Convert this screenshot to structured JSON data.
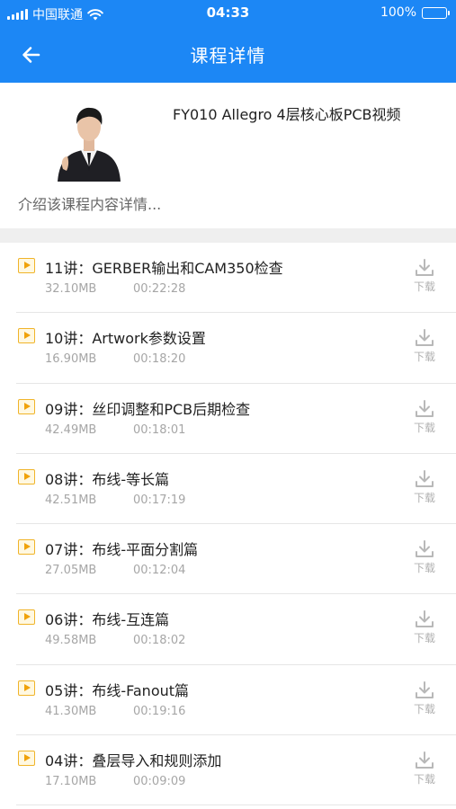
{
  "status_bar": {
    "carrier": "中国联通",
    "time": "04:33",
    "battery": "100%",
    "battery_color": "#4cd964"
  },
  "nav": {
    "title": "课程详情",
    "back_icon": "arrow-left-icon",
    "background": "#1c87f5"
  },
  "course": {
    "title": "FY010 Allegro 4层核心板PCB视频",
    "description": "介绍该课程内容详情..."
  },
  "lessons": [
    {
      "title": "11讲：GERBER输出和CAM350检查",
      "size": "32.10MB",
      "duration": "00:22:28",
      "download": "下载"
    },
    {
      "title": "10讲：Artwork参数设置",
      "size": "16.90MB",
      "duration": "00:18:20",
      "download": "下载"
    },
    {
      "title": "09讲：丝印调整和PCB后期检查",
      "size": "42.49MB",
      "duration": "00:18:01",
      "download": "下载"
    },
    {
      "title": "08讲：布线-等长篇",
      "size": "42.51MB",
      "duration": "00:17:19",
      "download": "下载"
    },
    {
      "title": "07讲：布线-平面分割篇",
      "size": "27.05MB",
      "duration": "00:12:04",
      "download": "下载"
    },
    {
      "title": "06讲：布线-互连篇",
      "size": "49.58MB",
      "duration": "00:18:02",
      "download": "下载"
    },
    {
      "title": "05讲：布线-Fanout篇",
      "size": "41.30MB",
      "duration": "00:19:16",
      "download": "下载"
    },
    {
      "title": "04讲：叠层导入和规则添加",
      "size": "17.10MB",
      "duration": "00:09:09",
      "download": "下载"
    }
  ]
}
